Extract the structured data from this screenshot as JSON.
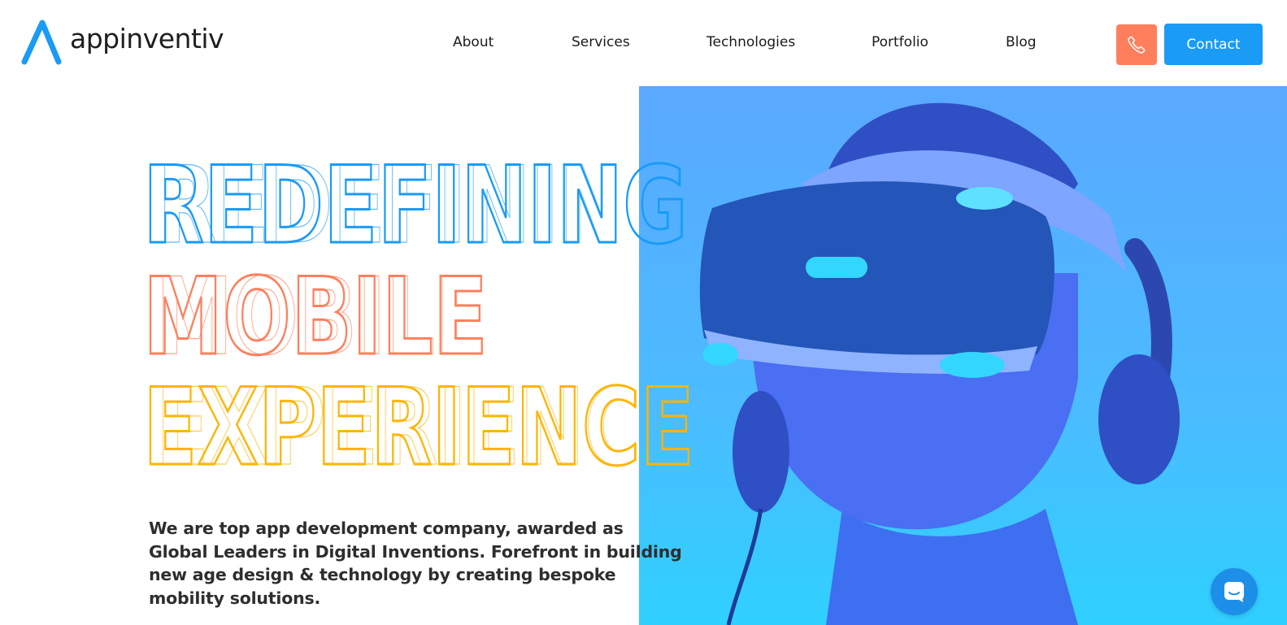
{
  "brand": {
    "name": "appinventiv",
    "accent": "#1a9bf6"
  },
  "nav": {
    "items": [
      {
        "label": "About"
      },
      {
        "label": "Services"
      },
      {
        "label": "Technologies"
      },
      {
        "label": "Portfolio"
      },
      {
        "label": "Blog"
      }
    ],
    "phone_icon": "phone-icon",
    "contact_label": "Contact"
  },
  "hero": {
    "lines": [
      {
        "text": "REDEFINING",
        "color": "#1a9bf6"
      },
      {
        "text": "MOBILE",
        "color": "#ff7f5d"
      },
      {
        "text": "EXPERIENCE",
        "color": "#ffb400"
      }
    ],
    "tagline": "We are top app development company, awarded as Global Leaders in Digital Inventions. Forefront in building new age design & technology by creating bespoke mobility solutions.",
    "image_subject": "person wearing vr headset and headphones"
  },
  "chat": {
    "icon": "chat-icon"
  }
}
